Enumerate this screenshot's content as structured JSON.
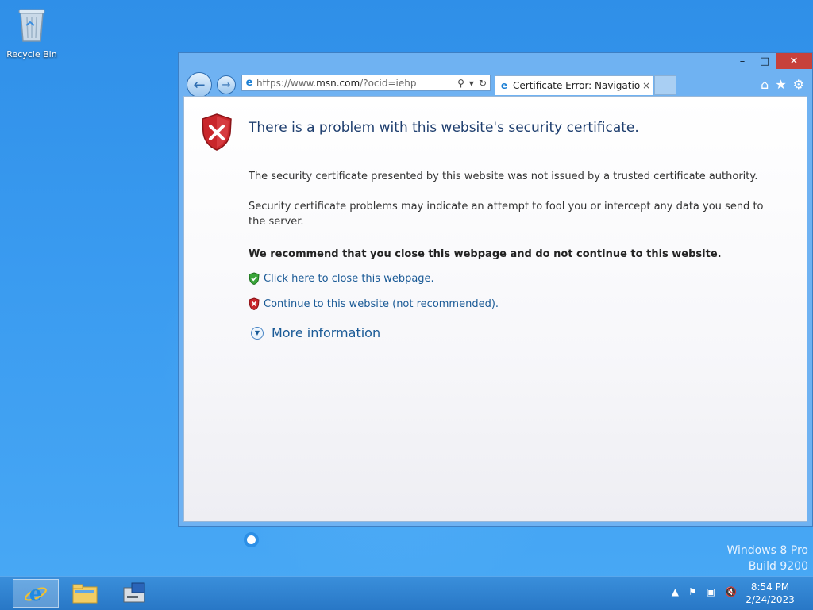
{
  "desktop": {
    "recycle_bin_label": "Recycle Bin",
    "watermark_line1": "Windows 8 Pro",
    "watermark_line2": "Build 9200"
  },
  "browser": {
    "address_prefix": "https://www.",
    "address_domain": "msn.com",
    "address_suffix": "/?ocid=iehp",
    "tab_label": "Certificate Error: Navigation...",
    "tab_close": "×",
    "window_controls": {
      "minimize": "–",
      "maximize": "□",
      "close": "✕"
    }
  },
  "page": {
    "heading": "There is a problem with this website's security certificate.",
    "para1": "The security certificate presented by this website was not issued by a trusted certificate authority.",
    "para2": "Security certificate problems may indicate an attempt to fool you or intercept any data you send to the server.",
    "recommendation": "We recommend that you close this webpage and do not continue to this website.",
    "close_link": "Click here to close this webpage.",
    "continue_link": "Continue to this website (not recommended).",
    "more_info": "More information"
  },
  "taskbar": {
    "time": "8:54 PM",
    "date": "2/24/2023"
  },
  "colors": {
    "desktop": "#3a9bf0",
    "link": "#1a5a96",
    "heading": "#1e3e6e",
    "close_button": "#c7413b"
  }
}
